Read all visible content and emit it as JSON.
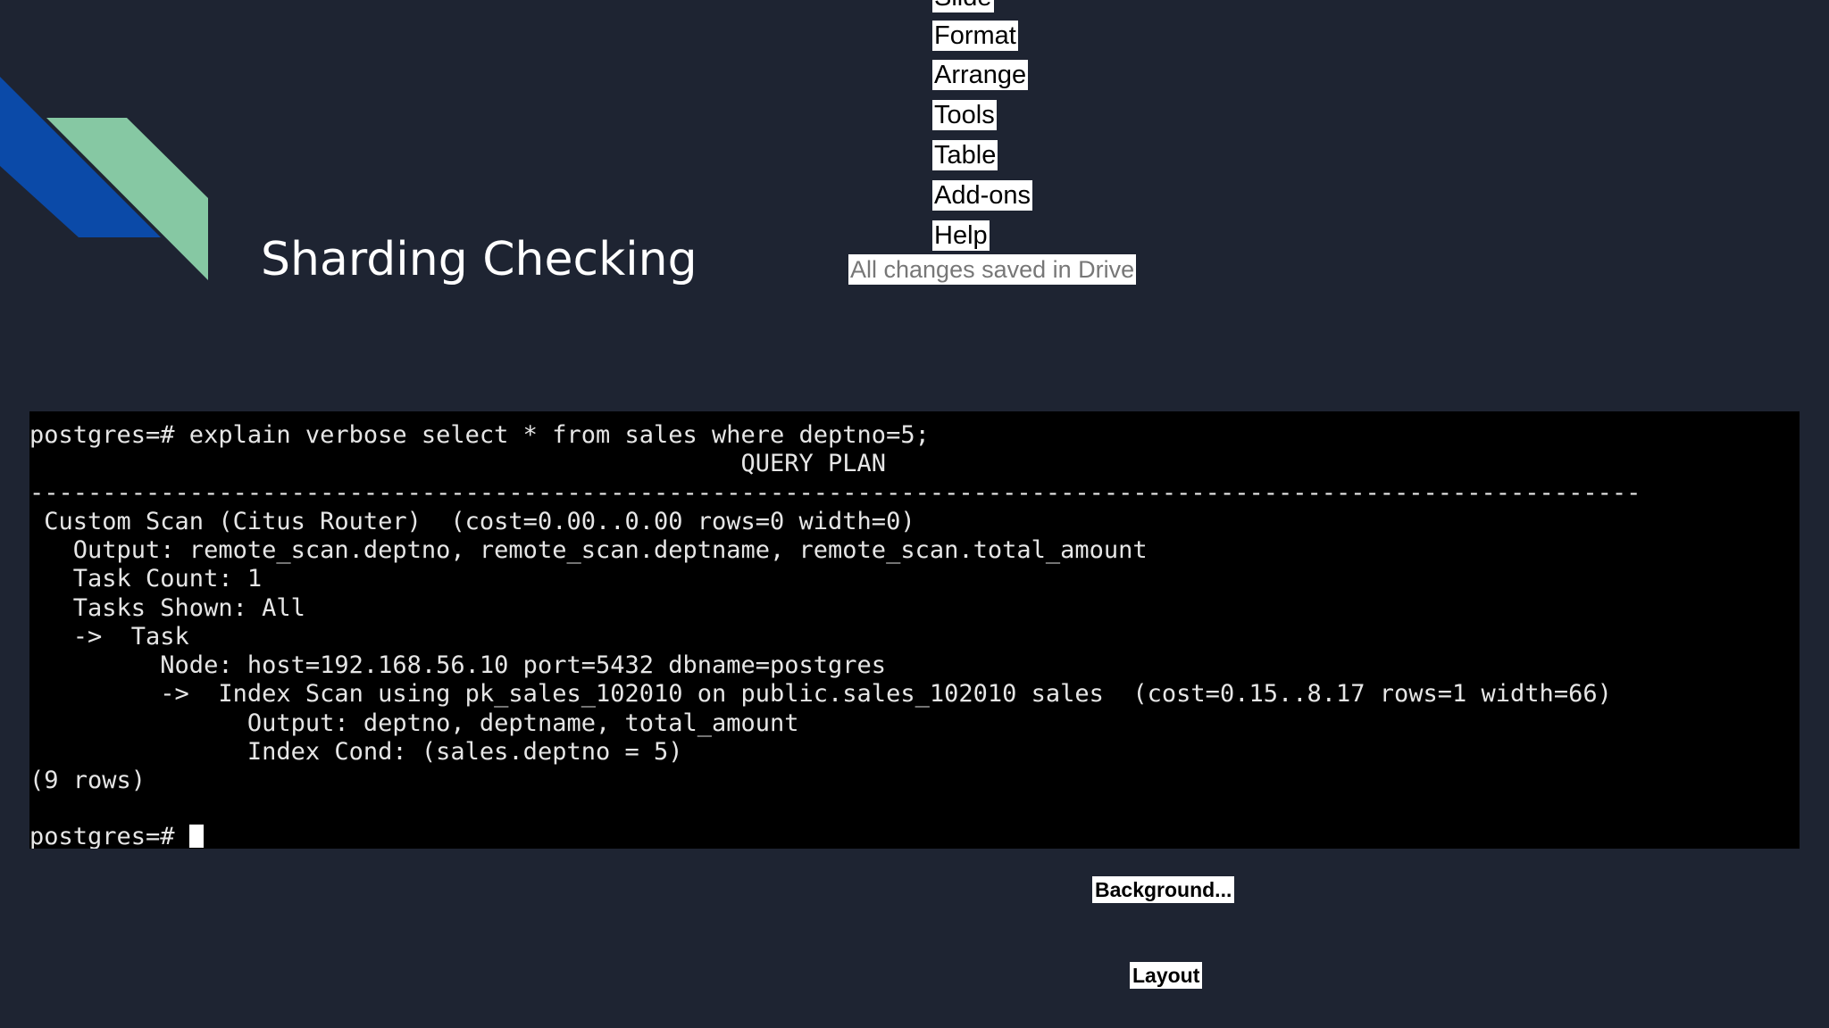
{
  "colors": {
    "background": "#1e2432",
    "accent_blue": "#0b4aa8",
    "accent_green": "#86c8a3",
    "terminal_bg": "#000000",
    "terminal_text": "#e6e6e6"
  },
  "menu": {
    "items": [
      {
        "label": "Slide"
      },
      {
        "label": "Format"
      },
      {
        "label": "Arrange"
      },
      {
        "label": "Tools"
      },
      {
        "label": "Table"
      },
      {
        "label": "Add-ons"
      },
      {
        "label": "Help"
      }
    ]
  },
  "status": {
    "save_text": "All changes saved in Drive"
  },
  "slide": {
    "title": "Sharding Checking"
  },
  "terminal": {
    "lines": [
      "postgres=# explain verbose select * from sales where deptno=5;",
      "                                                 QUERY PLAN",
      "---------------------------------------------------------------------------------------------------------------",
      " Custom Scan (Citus Router)  (cost=0.00..0.00 rows=0 width=0)",
      "   Output: remote_scan.deptno, remote_scan.deptname, remote_scan.total_amount",
      "   Task Count: 1",
      "   Tasks Shown: All",
      "   ->  Task",
      "         Node: host=192.168.56.10 port=5432 dbname=postgres",
      "         ->  Index Scan using pk_sales_102010 on public.sales_102010 sales  (cost=0.15..8.17 rows=1 width=66)",
      "               Output: deptno, deptname, total_amount",
      "               Index Cond: (sales.deptno = 5)",
      "(9 rows)",
      ""
    ],
    "prompt": "postgres=#"
  },
  "buttons": {
    "background_label": "Background...",
    "layout_label": "Layout"
  }
}
